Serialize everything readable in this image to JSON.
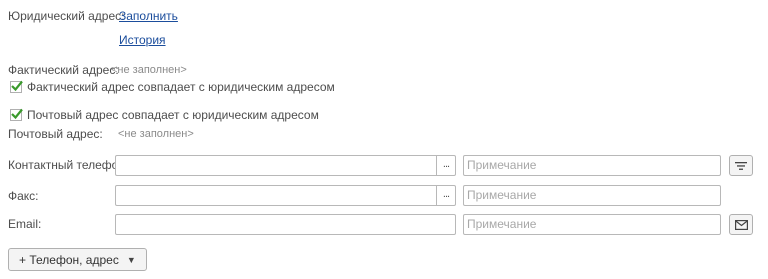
{
  "legal_address": {
    "label": "Юридический адрес:",
    "fill_link": "Заполнить",
    "history_link": "История"
  },
  "actual_address": {
    "label": "Фактический адрес:",
    "value": "<не заполнен>",
    "same_checkbox_label": "Фактический адрес совпадает с юридическим адресом",
    "same_checked": true
  },
  "postal_address": {
    "same_checkbox_label": "Почтовый адрес совпадает с юридическим адресом",
    "same_checked": true,
    "label": "Почтовый адрес:",
    "value": "<не заполнен>"
  },
  "contacts": {
    "phone_label": "Контактный телефон:",
    "fax_label": "Факс:",
    "email_label": "Email:",
    "note_placeholder": "Примечание",
    "dots_label": "..."
  },
  "add_button": {
    "label": "+ Телефон, адрес",
    "arrow": "▼"
  }
}
